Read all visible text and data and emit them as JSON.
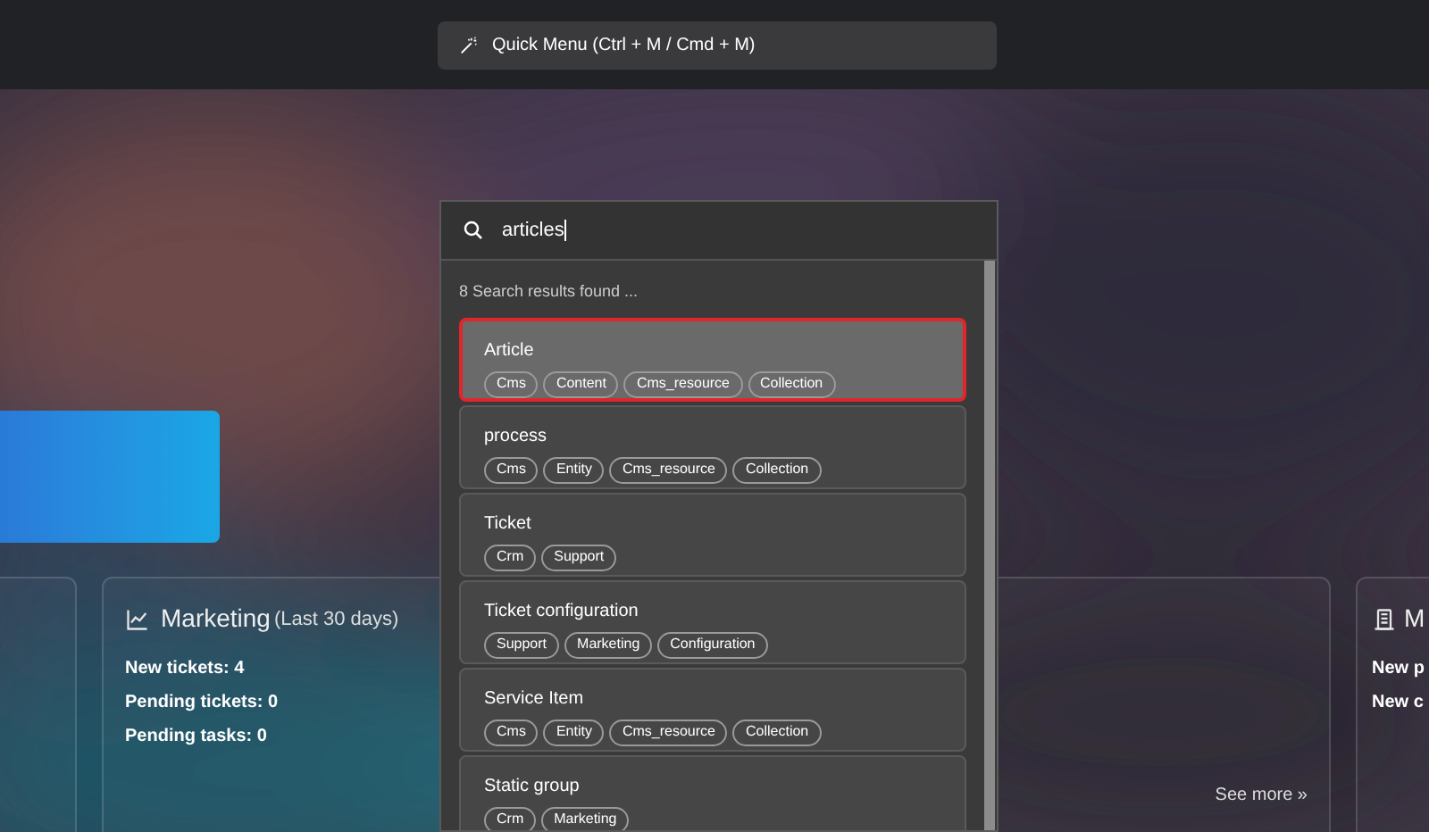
{
  "top_bar": {
    "quick_menu": "Quick Menu (Ctrl + M / Cmd + M)"
  },
  "cards": [
    {
      "kind": "empty"
    },
    {
      "kind": "stats",
      "title": "Marketing",
      "subtitle": "(Last 30 days)",
      "lines": [
        "New tickets: 4",
        "Pending tickets: 0",
        "Pending tasks: 0"
      ],
      "link": "See more »"
    },
    {
      "kind": "stats",
      "title": "M",
      "lines": [
        "New p",
        "New c"
      ]
    }
  ],
  "search": {
    "value": "articles",
    "result_count": "8 Search results found ...",
    "results": [
      {
        "title": "Article",
        "selected": true,
        "tags": [
          "Cms",
          "Content",
          "Cms_resource",
          "Collection"
        ]
      },
      {
        "title": "process",
        "selected": false,
        "tags": [
          "Cms",
          "Entity",
          "Cms_resource",
          "Collection"
        ]
      },
      {
        "title": "Ticket",
        "selected": false,
        "tags": [
          "Crm",
          "Support"
        ]
      },
      {
        "title": "Ticket configuration",
        "selected": false,
        "tags": [
          "Support",
          "Marketing",
          "Configuration"
        ]
      },
      {
        "title": "Service Item",
        "selected": false,
        "tags": [
          "Cms",
          "Entity",
          "Cms_resource",
          "Collection"
        ]
      },
      {
        "title": "Static group",
        "selected": false,
        "tags": [
          "Crm",
          "Marketing"
        ]
      }
    ]
  }
}
